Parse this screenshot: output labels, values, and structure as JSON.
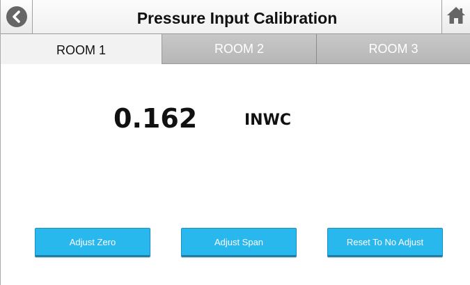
{
  "header": {
    "title": "Pressure Input Calibration",
    "back_icon": "chevron-left-circle-icon",
    "home_icon": "home-icon"
  },
  "tabs": [
    {
      "label": "ROOM 1",
      "active": true
    },
    {
      "label": "ROOM 2",
      "active": false
    },
    {
      "label": "ROOM 3",
      "active": false
    }
  ],
  "reading": {
    "value": "0.162",
    "unit": "INWC"
  },
  "actions": {
    "adjust_zero": "Adjust Zero",
    "adjust_span": "Adjust Span",
    "reset": "Reset To No Adjust"
  },
  "colors": {
    "button_blue": "#29b8ee",
    "tab_inactive": "#bebebe",
    "tab_active": "#f2f2f2",
    "icon_gray": "#666666"
  }
}
